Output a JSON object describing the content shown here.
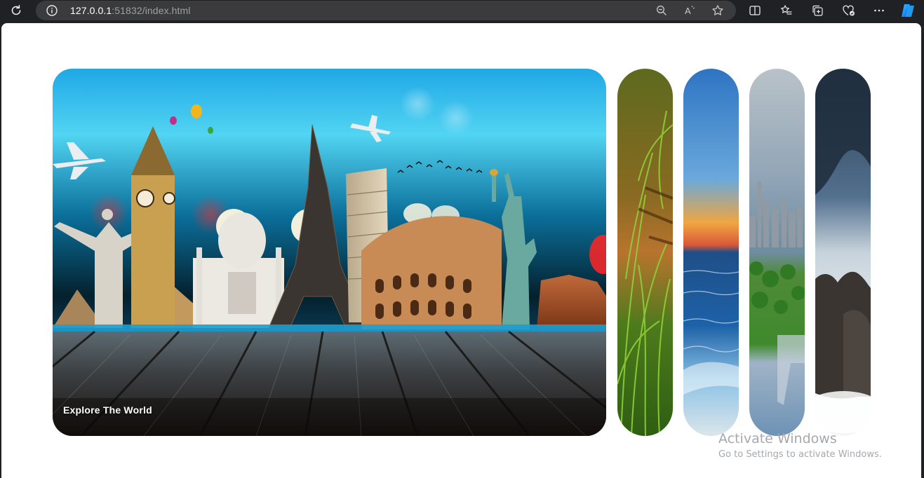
{
  "browser": {
    "url_host": "127.0.0.1",
    "url_rest": ":51832/index.html",
    "icons": [
      "reload-icon",
      "site-info-icon",
      "zoom-out-icon",
      "read-aloud-icon",
      "favorite-star-icon",
      "split-screen-icon",
      "favorites-icon",
      "collections-icon",
      "browser-essentials-icon",
      "more-icon",
      "copilot-icon"
    ]
  },
  "gallery": {
    "main_card": {
      "caption": "Explore The World",
      "scene": "world-landmarks"
    },
    "strips": [
      {
        "scene": "grass-tiger"
      },
      {
        "scene": "ocean-sunset"
      },
      {
        "scene": "city-park"
      },
      {
        "scene": "misty-mountains"
      }
    ]
  },
  "watermark": {
    "title": "Activate Windows",
    "subtitle": "Go to Settings to activate Windows."
  },
  "colors": {
    "chrome_bg": "#202124",
    "omnibox_bg": "#3b3b3d",
    "page_bg": "#ffffff",
    "copilot_blue": "#1f8fff"
  }
}
